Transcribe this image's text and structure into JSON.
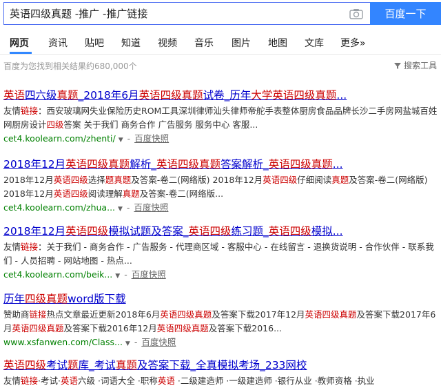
{
  "search": {
    "query": "英语四级真题 -推广 -推广链接",
    "button": "百度一下"
  },
  "tabs": [
    {
      "label": "网页",
      "active": true
    },
    {
      "label": "资讯"
    },
    {
      "label": "贴吧"
    },
    {
      "label": "知道"
    },
    {
      "label": "视频"
    },
    {
      "label": "音乐"
    },
    {
      "label": "图片"
    },
    {
      "label": "地图"
    },
    {
      "label": "文库"
    },
    {
      "label": "更多»"
    }
  ],
  "result_count": "百度为您找到相关结果约680,000个",
  "tools_label": "搜索工具",
  "snapshot_label": "百度快照",
  "colors": {
    "title": "#0000cc",
    "highlight": "#cc0000",
    "url": "#008000",
    "button": "#3385ff"
  },
  "results": [
    {
      "title": [
        [
          "英语",
          1
        ],
        [
          "四六级",
          0
        ],
        [
          "真题",
          1
        ],
        [
          "_2018年6月",
          0
        ],
        [
          "英语四级真题",
          1
        ],
        [
          "试卷_历年",
          0
        ],
        [
          "大学英语四级真题",
          1
        ],
        [
          "...",
          0
        ]
      ],
      "abstract": [
        [
          "友情",
          0
        ],
        [
          "链接",
          1
        ],
        [
          "：西安玻璃网失业保险历史ROM工具深圳律师汕头律师帝舵手表整体厨房食品品牌长沙二手房网盐城百姓网厨房设计",
          0
        ],
        [
          "四级",
          1
        ],
        [
          "答案 关于我们 商务合作 广告服务 服务中心 客服...",
          0
        ]
      ],
      "url": "cet4.koolearn.com/zhenti/"
    },
    {
      "title": [
        [
          "2018年12月",
          0
        ],
        [
          "英语四级真题",
          1
        ],
        [
          "解析_",
          0
        ],
        [
          "英语四级真题",
          1
        ],
        [
          "答案解析_",
          0
        ],
        [
          "英语四级真题",
          1
        ],
        [
          "...",
          0
        ]
      ],
      "abstract": [
        [
          "2018年12月",
          0
        ],
        [
          "英语四级",
          1
        ],
        [
          "选择",
          0
        ],
        [
          "题",
          1
        ],
        [
          "真题",
          1
        ],
        [
          "及答案-卷二(网络版) 2018年12月",
          0
        ],
        [
          "英语四级",
          1
        ],
        [
          "仔细阅读",
          0
        ],
        [
          "真题",
          1
        ],
        [
          "及答案-卷二(网络版) 2018年12月",
          0
        ],
        [
          "英语四级",
          1
        ],
        [
          "阅读理解",
          0
        ],
        [
          "真题",
          1
        ],
        [
          "及答案-卷二(网络版...",
          0
        ]
      ],
      "url": "cet4.koolearn.com/zhua..."
    },
    {
      "title": [
        [
          "2018年12月",
          0
        ],
        [
          "英语四级",
          1
        ],
        [
          "模拟试题及答案_",
          0
        ],
        [
          "英语四级",
          1
        ],
        [
          "练习题_",
          0
        ],
        [
          "英语四级",
          1
        ],
        [
          "模拟...",
          0
        ]
      ],
      "abstract": [
        [
          "友情",
          0
        ],
        [
          "链接",
          1
        ],
        [
          "：关于我们 - 商务合作 - 广告服务 - 代理商区域 - 客服中心 - 在线留言 - 退换货说明 - 合作伙伴 - 联系我们 - 人员招聘 - 网站地图 - 热点...",
          0
        ]
      ],
      "url": "cet4.koolearn.com/beik..."
    },
    {
      "title": [
        [
          "历年",
          0
        ],
        [
          "四级真题",
          1
        ],
        [
          "word版下载",
          0
        ]
      ],
      "abstract": [
        [
          "赞助商",
          0
        ],
        [
          "链接",
          1
        ],
        [
          "热点文章最近更新2018年6月",
          0
        ],
        [
          "英语四级真题",
          1
        ],
        [
          "及答案下载2017年12月",
          0
        ],
        [
          "英语四级真题",
          1
        ],
        [
          "及答案下载2017年6月",
          0
        ],
        [
          "英语四级真题",
          1
        ],
        [
          "及答案下载2016年12月",
          0
        ],
        [
          "英语四级真题",
          1
        ],
        [
          "及答案下载2016...",
          0
        ]
      ],
      "url": "www.xsfanwen.com/Class..."
    },
    {
      "title": [
        [
          "英语四级",
          1
        ],
        [
          "考试",
          0
        ],
        [
          "题",
          1
        ],
        [
          "库_考试",
          0
        ],
        [
          "真题",
          1
        ],
        [
          "及答案下载_全真模拟考场_233网校",
          0
        ]
      ],
      "abstract": [
        [
          "友情",
          0
        ],
        [
          "链接",
          1
        ],
        [
          "·考试",
          0
        ],
        [
          "·",
          0
        ],
        [
          "英语",
          1
        ],
        [
          "六级 ·词语大全 ·职称",
          0
        ],
        [
          "英语",
          1
        ],
        [
          " ·二级建造师 ·一级建造师 ·银行从业 ·教师资格 ·执业",
          0
        ]
      ],
      "url": ""
    }
  ]
}
